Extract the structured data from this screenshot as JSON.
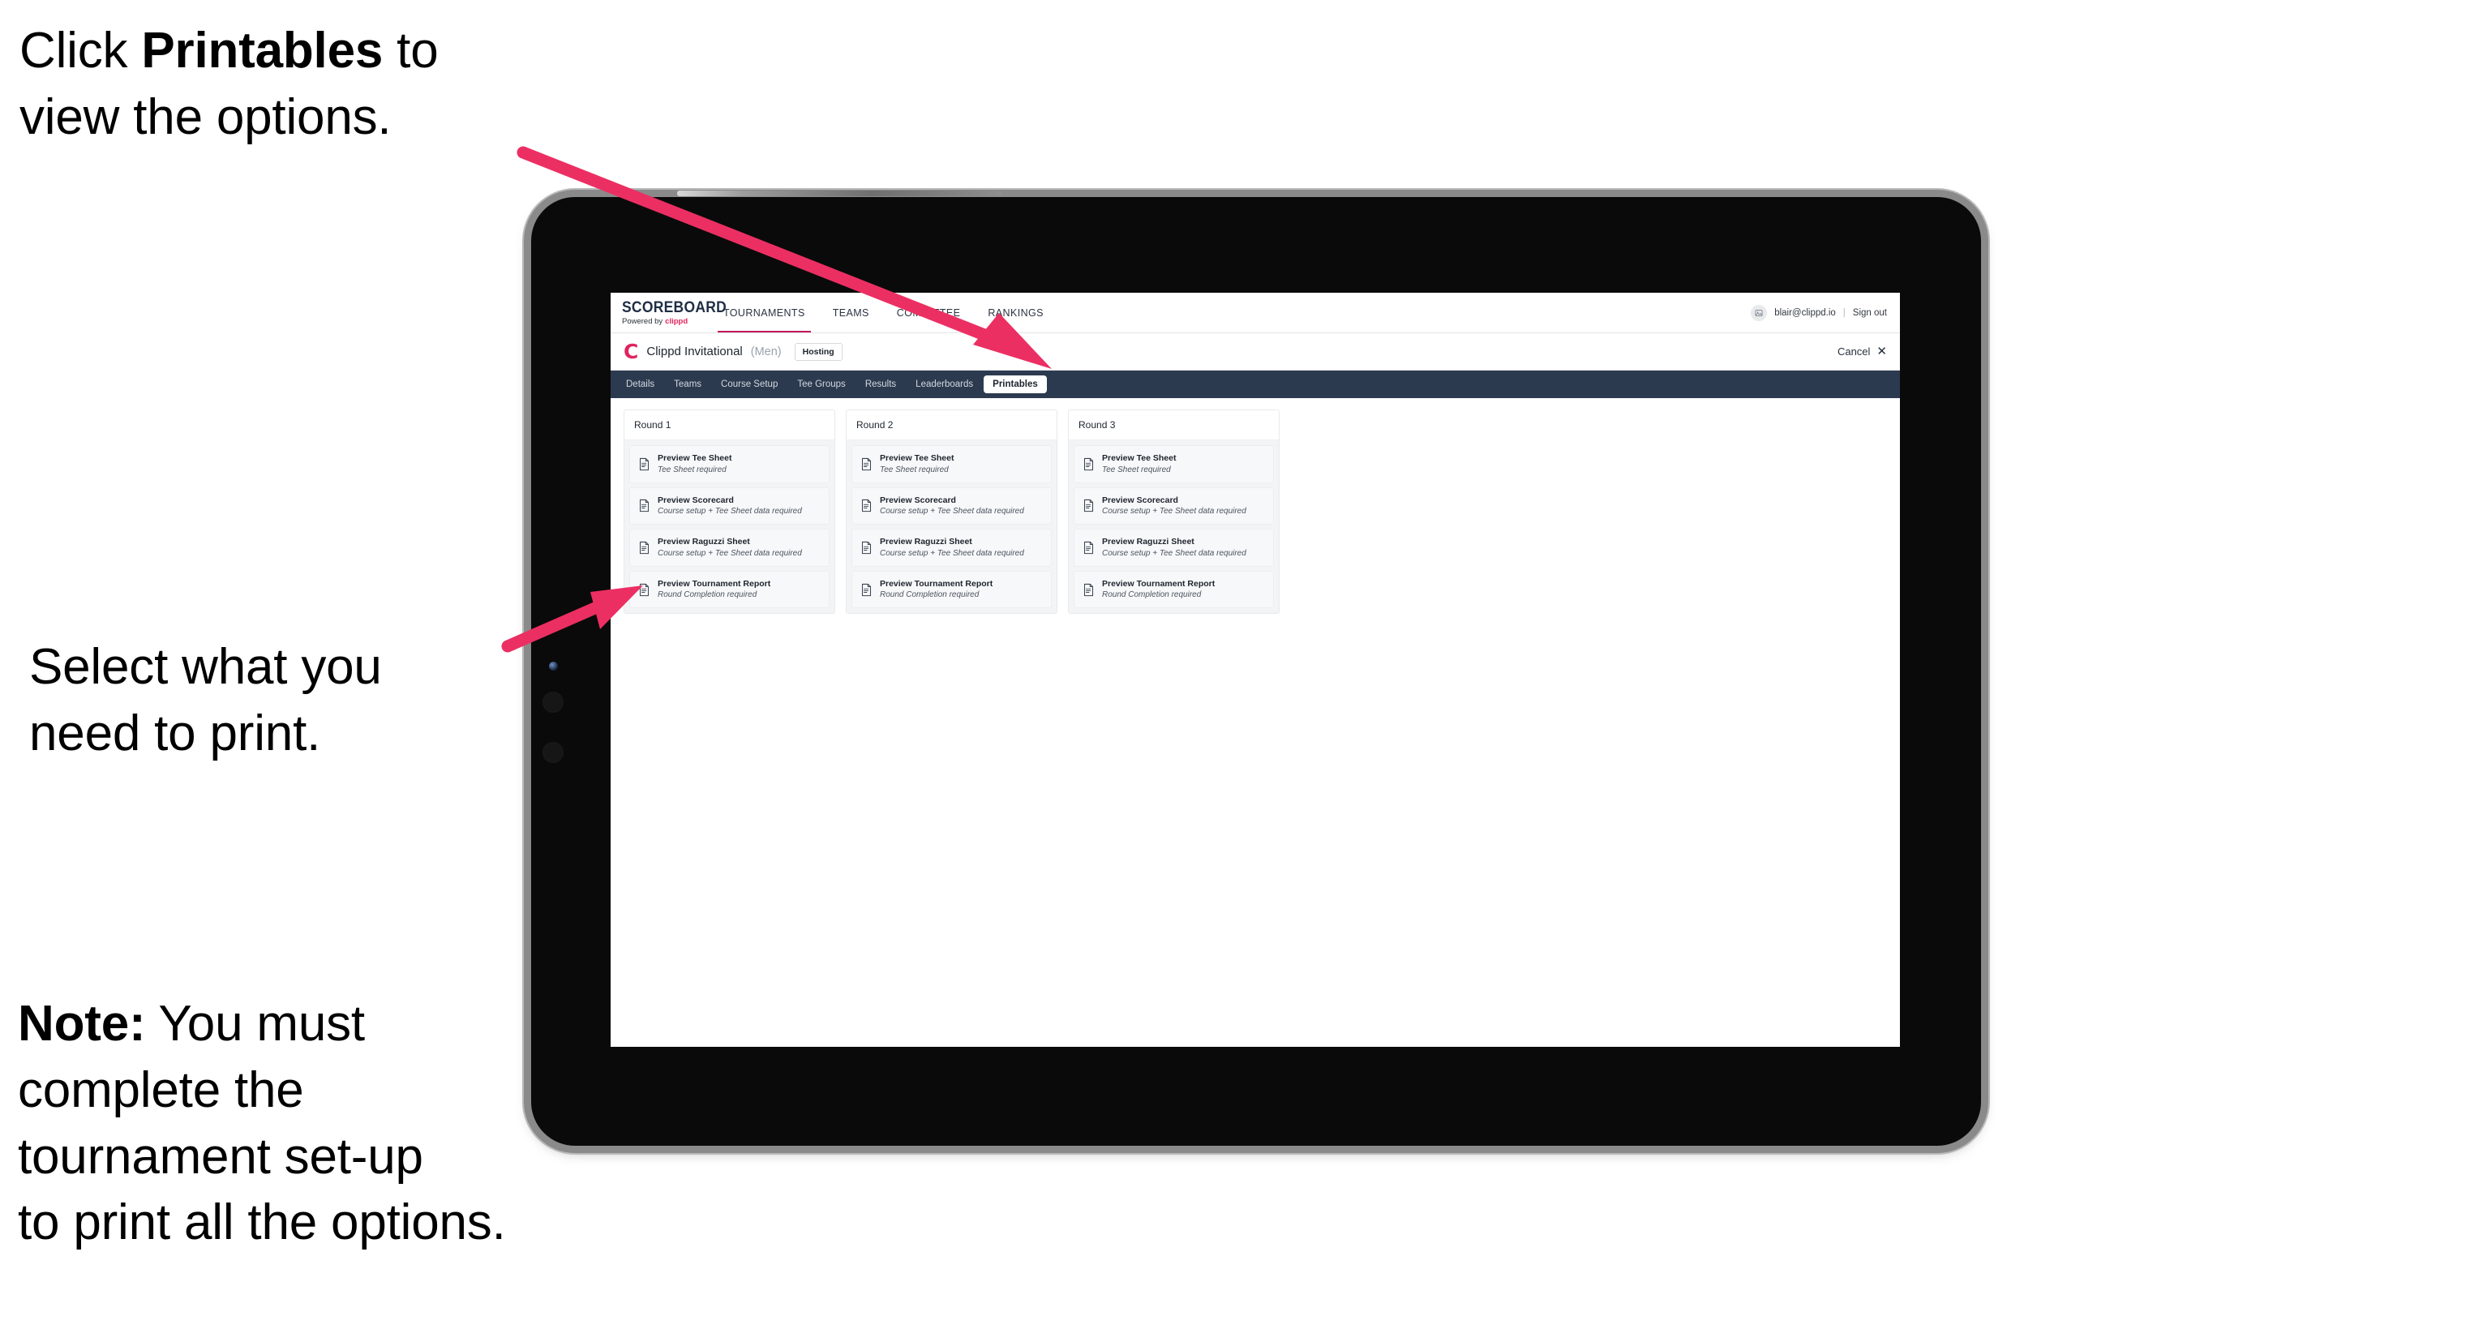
{
  "annotations": {
    "click_printables": {
      "before": "Click ",
      "bold": "Printables",
      "after": " to\nview the options."
    },
    "select_print": "Select what you\n need to print.",
    "note": {
      "bold": "Note:",
      "rest": " You must\ncomplete the\ntournament set-up\nto print all the options."
    }
  },
  "colors": {
    "accent_pink": "#e0245e",
    "arrow_pink": "#ec2f63",
    "tabbar_navy": "#2c3a4f",
    "brand_navy": "#1f2d44"
  },
  "topnav": {
    "brand_title": "SCOREBOARD",
    "brand_powered": "Powered by",
    "brand_clippd": "clippd",
    "items": [
      {
        "label": "TOURNAMENTS",
        "active": true
      },
      {
        "label": "TEAMS",
        "active": false
      },
      {
        "label": "COMMITTEE",
        "active": false
      },
      {
        "label": "RANKINGS",
        "active": false
      }
    ],
    "avatar_icon": "user-avatar-icon",
    "user_email": "blair@clippd.io",
    "separator": "|",
    "sign_out": "Sign out"
  },
  "subheader": {
    "logo_mark": "C",
    "tournament_name": "Clippd Invitational",
    "gender": "(Men)",
    "badge": "Hosting",
    "cancel_label": "Cancel",
    "cancel_icon": "close-x-icon"
  },
  "tabs": [
    {
      "label": "Details",
      "active": false
    },
    {
      "label": "Teams",
      "active": false
    },
    {
      "label": "Course Setup",
      "active": false
    },
    {
      "label": "Tee Groups",
      "active": false
    },
    {
      "label": "Results",
      "active": false
    },
    {
      "label": "Leaderboards",
      "active": false
    },
    {
      "label": "Printables",
      "active": true
    }
  ],
  "rounds": [
    {
      "header": "Round 1",
      "items": [
        {
          "icon": "document-icon",
          "title": "Preview Tee Sheet",
          "subtitle": "Tee Sheet required"
        },
        {
          "icon": "document-icon",
          "title": "Preview Scorecard",
          "subtitle": "Course setup + Tee Sheet data required"
        },
        {
          "icon": "document-icon",
          "title": "Preview Raguzzi Sheet",
          "subtitle": "Course setup + Tee Sheet data required"
        },
        {
          "icon": "document-icon",
          "title": "Preview Tournament Report",
          "subtitle": "Round Completion required"
        }
      ]
    },
    {
      "header": "Round 2",
      "items": [
        {
          "icon": "document-icon",
          "title": "Preview Tee Sheet",
          "subtitle": "Tee Sheet required"
        },
        {
          "icon": "document-icon",
          "title": "Preview Scorecard",
          "subtitle": "Course setup + Tee Sheet data required"
        },
        {
          "icon": "document-icon",
          "title": "Preview Raguzzi Sheet",
          "subtitle": "Course setup + Tee Sheet data required"
        },
        {
          "icon": "document-icon",
          "title": "Preview Tournament Report",
          "subtitle": "Round Completion required"
        }
      ]
    },
    {
      "header": "Round 3",
      "items": [
        {
          "icon": "document-icon",
          "title": "Preview Tee Sheet",
          "subtitle": "Tee Sheet required"
        },
        {
          "icon": "document-icon",
          "title": "Preview Scorecard",
          "subtitle": "Course setup + Tee Sheet data required"
        },
        {
          "icon": "document-icon",
          "title": "Preview Raguzzi Sheet",
          "subtitle": "Course setup + Tee Sheet data required"
        },
        {
          "icon": "document-icon",
          "title": "Preview Tournament Report",
          "subtitle": "Round Completion required"
        }
      ]
    }
  ]
}
